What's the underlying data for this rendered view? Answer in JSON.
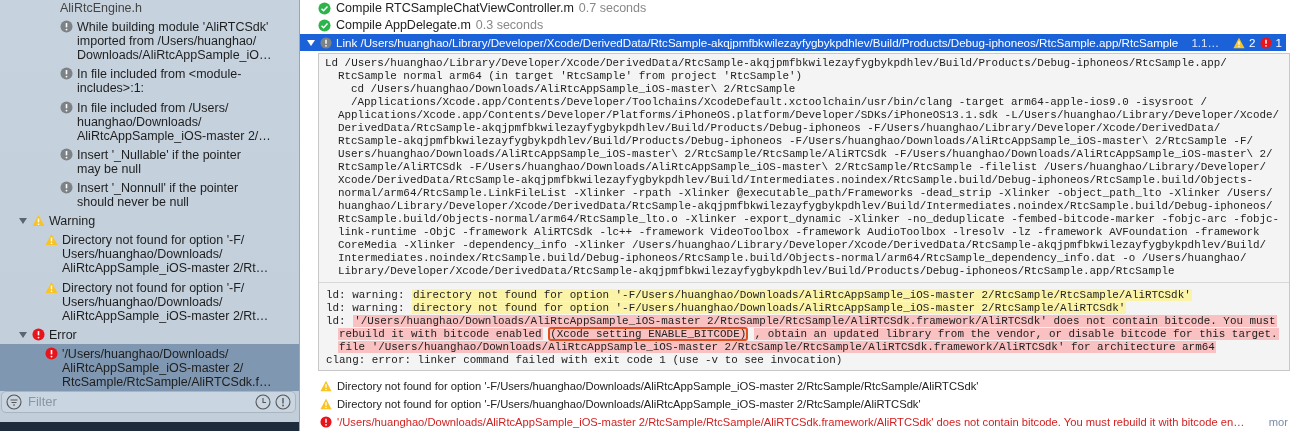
{
  "sidebar": {
    "items": [
      {
        "kind": "file",
        "label": "AliRtcEngine.h",
        "children": [
          {
            "kind": "note",
            "label": "While building module 'AliRTCSdk'\nimported from /Users/huanghao/\nDownloads/AliRtcAppSample_iO…"
          },
          {
            "kind": "note",
            "label": "In file included from <module-\nincludes>:1:"
          },
          {
            "kind": "note",
            "label": "In file included from /Users/\nhuanghao/Downloads/\nAliRtcAppSample_iOS-master 2/…"
          },
          {
            "kind": "note",
            "label": "Insert '_Nullable' if the pointer\nmay be null"
          },
          {
            "kind": "note",
            "label": "Insert '_Nonnull' if the pointer\nshould never be null"
          }
        ]
      },
      {
        "kind": "warning",
        "label": "Warning",
        "expanded": true,
        "children": [
          {
            "kind": "warning",
            "label": "Directory not found for option '-F/\nUsers/huanghao/Downloads/\nAliRtcAppSample_iOS-master 2/Rt…",
            "selected": false
          },
          {
            "kind": "warning",
            "label": "Directory not found for option '-F/\nUsers/huanghao/Downloads/\nAliRtcAppSample_iOS-master 2/Rt…",
            "selected": false
          }
        ]
      },
      {
        "kind": "error",
        "label": "Error",
        "expanded": true,
        "children": [
          {
            "kind": "error",
            "label": "'/Users/huanghao/Downloads/\nAliRtcAppSample_iOS-master 2/\nRtcSample/RtcSample/AliRTCSdk.f…",
            "selected": true
          }
        ]
      }
    ],
    "filter": {
      "placeholder": "Filter"
    }
  },
  "build_log": {
    "steps": [
      {
        "kind": "success",
        "label": "Compile RTCSampleChatViewController.m",
        "duration": "0.7 seconds"
      },
      {
        "kind": "success",
        "label": "Compile AppDelegate.m",
        "duration": "0.3 seconds"
      }
    ],
    "link_step": {
      "expanded": true,
      "selected": true,
      "label": "Link /Users/huanghao/Library/Developer/Xcode/DerivedData/RtcSample-akqjpmfbkwilezayfygbykpdhlev/Build/Products/Debug-iphoneos/RtcSample.app/RtcSample",
      "duration": "1.1…",
      "warning_count": "2",
      "error_count": "1"
    },
    "command_lines": [
      {
        "kind": "command",
        "text": "Ld /Users/huanghao/Library/Developer/Xcode/DerivedData/RtcSample-akqjpmfbkwilezayfygbykpdhlev/Build/Products/Debug-iphoneos/RtcSample.app/"
      },
      {
        "kind": "continuation",
        "text": "RtcSample normal arm64 (in target 'RtcSample' from project 'RtcSample')"
      },
      {
        "kind": "subcommand",
        "text": "cd /Users/huanghao/Downloads/AliRtcAppSample_iOS-master\\ 2/RtcSample"
      },
      {
        "kind": "subcommand",
        "text": "/Applications/Xcode.app/Contents/Developer/Toolchains/XcodeDefault.xctoolchain/usr/bin/clang -target arm64-apple-ios9.0 -isysroot /"
      },
      {
        "kind": "continuation",
        "text": "Applications/Xcode.app/Contents/Developer/Platforms/iPhoneOS.platform/Developer/SDKs/iPhoneOS13.1.sdk -L/Users/huanghao/Library/Developer/Xcode/"
      },
      {
        "kind": "continuation",
        "text": "DerivedData/RtcSample-akqjpmfbkwilezayfygbykpdhlev/Build/Products/Debug-iphoneos -F/Users/huanghao/Library/Developer/Xcode/DerivedData/"
      },
      {
        "kind": "continuation",
        "text": "RtcSample-akqjpmfbkwilezayfygbykpdhlev/Build/Products/Debug-iphoneos -F/Users/huanghao/Downloads/AliRtcAppSample_iOS-master\\ 2/RtcSample -F/"
      },
      {
        "kind": "continuation",
        "text": "Users/huanghao/Downloads/AliRtcAppSample_iOS-master\\ 2/RtcSample/RtcSample/AliRTCSdk -F/Users/huanghao/Downloads/AliRtcAppSample_iOS-master\\ 2/"
      },
      {
        "kind": "continuation",
        "text": "RtcSample/AliRTCSdk -F/Users/huanghao/Downloads/AliRtcAppSample_iOS-master\\ 2/RtcSample/RtcSample -filelist /Users/huanghao/Library/Developer/"
      },
      {
        "kind": "continuation",
        "text": "Xcode/DerivedData/RtcSample-akqjpmfbkwilezayfygbykpdhlev/Build/Intermediates.noindex/RtcSample.build/Debug-iphoneos/RtcSample.build/Objects-"
      },
      {
        "kind": "continuation",
        "text": "normal/arm64/RtcSample.LinkFileList -Xlinker -rpath -Xlinker @executable_path/Frameworks -dead_strip -Xlinker -object_path_lto -Xlinker /Users/"
      },
      {
        "kind": "continuation",
        "text": "huanghao/Library/Developer/Xcode/DerivedData/RtcSample-akqjpmfbkwilezayfygbykpdhlev/Build/Intermediates.noindex/RtcSample.build/Debug-iphoneos/"
      },
      {
        "kind": "continuation",
        "text": "RtcSample.build/Objects-normal/arm64/RtcSample_lto.o -Xlinker -export_dynamic -Xlinker -no_deduplicate -fembed-bitcode-marker -fobjc-arc -fobjc-"
      },
      {
        "kind": "continuation",
        "text": "link-runtime -ObjC -framework AliRTCSdk -lc++ -framework VideoToolbox -framework AudioToolbox -lresolv -lz -framework AVFoundation -framework"
      },
      {
        "kind": "continuation",
        "text": "CoreMedia -Xlinker -dependency_info -Xlinker /Users/huanghao/Library/Developer/Xcode/DerivedData/RtcSample-akqjpmfbkwilezayfygbykpdhlev/Build/"
      },
      {
        "kind": "continuation",
        "text": "Intermediates.noindex/RtcSample.build/Debug-iphoneos/RtcSample.build/Objects-normal/arm64/RtcSample_dependency_info.dat -o /Users/huanghao/"
      },
      {
        "kind": "continuation",
        "text": "Library/Developer/Xcode/DerivedData/RtcSample-akqjpmfbkwilezayfygbykpdhlev/Build/Products/Debug-iphoneos/RtcSample.app/RtcSample"
      }
    ],
    "output_lines": [
      {
        "kind": "command",
        "segments": [
          {
            "kind": "plain",
            "text": "ld: warning:"
          },
          {
            "kind": "warning",
            "text": "directory not found for option '-F/Users/huanghao/Downloads/AliRtcAppSample_iOS-master 2/RtcSample/RtcSample/AliRTCSdk'"
          }
        ]
      },
      {
        "kind": "command",
        "segments": [
          {
            "kind": "plain",
            "text": "ld: warning:"
          },
          {
            "kind": "warning",
            "text": "directory not found for option '-F/Users/huanghao/Downloads/AliRtcAppSample_iOS-master 2/RtcSample/AliRTCSdk'"
          }
        ]
      },
      {
        "kind": "command",
        "segments": [
          {
            "kind": "plain",
            "text": "ld:"
          },
          {
            "kind": "error",
            "text": "'/Users/huanghao/Downloads/AliRtcAppSample_iOS-master 2/RtcSample/RtcSample/AliRTCSdk.framework/AliRTCSdk' does not contain bitcode. You must"
          }
        ]
      },
      {
        "kind": "continuation",
        "segments": [
          {
            "kind": "error",
            "text": "rebuild it with bitcode enabled"
          },
          {
            "kind": "callout",
            "text": "(Xcode setting ENABLE_BITCODE)"
          },
          {
            "kind": "error",
            "text": ", obtain an updated library from the vendor, or disable bitcode for this target."
          }
        ]
      },
      {
        "kind": "continuation",
        "segments": [
          {
            "kind": "error",
            "text": "file '/Users/huanghao/Downloads/AliRtcAppSample_iOS-master 2/RtcSample/RtcSample/AliRTCSdk.framework/AliRTCSdk' for architecture arm64"
          }
        ]
      },
      {
        "kind": "command",
        "segments": [
          {
            "kind": "plain",
            "text": "clang: error: linker command failed with exit code 1 (use -v to see invocation)"
          }
        ]
      }
    ],
    "issues": [
      {
        "kind": "warning",
        "text": "Directory not found for option '-F/Users/huanghao/Downloads/AliRtcAppSample_iOS-master 2/RtcSample/RtcSample/AliRTCSdk'"
      },
      {
        "kind": "warning",
        "text": "Directory not found for option '-F/Users/huanghao/Downloads/AliRtcAppSample_iOS-master 2/RtcSample/AliRTCSdk'"
      },
      {
        "kind": "error",
        "text": "'/Users/huanghao/Downloads/AliRtcAppSample_iOS-master 2/RtcSample/RtcSample/AliRTCSdk.framework/AliRTCSdk' does not contain bitcode. You must rebuild it with bitcode en…",
        "more": "mor"
      }
    ]
  }
}
